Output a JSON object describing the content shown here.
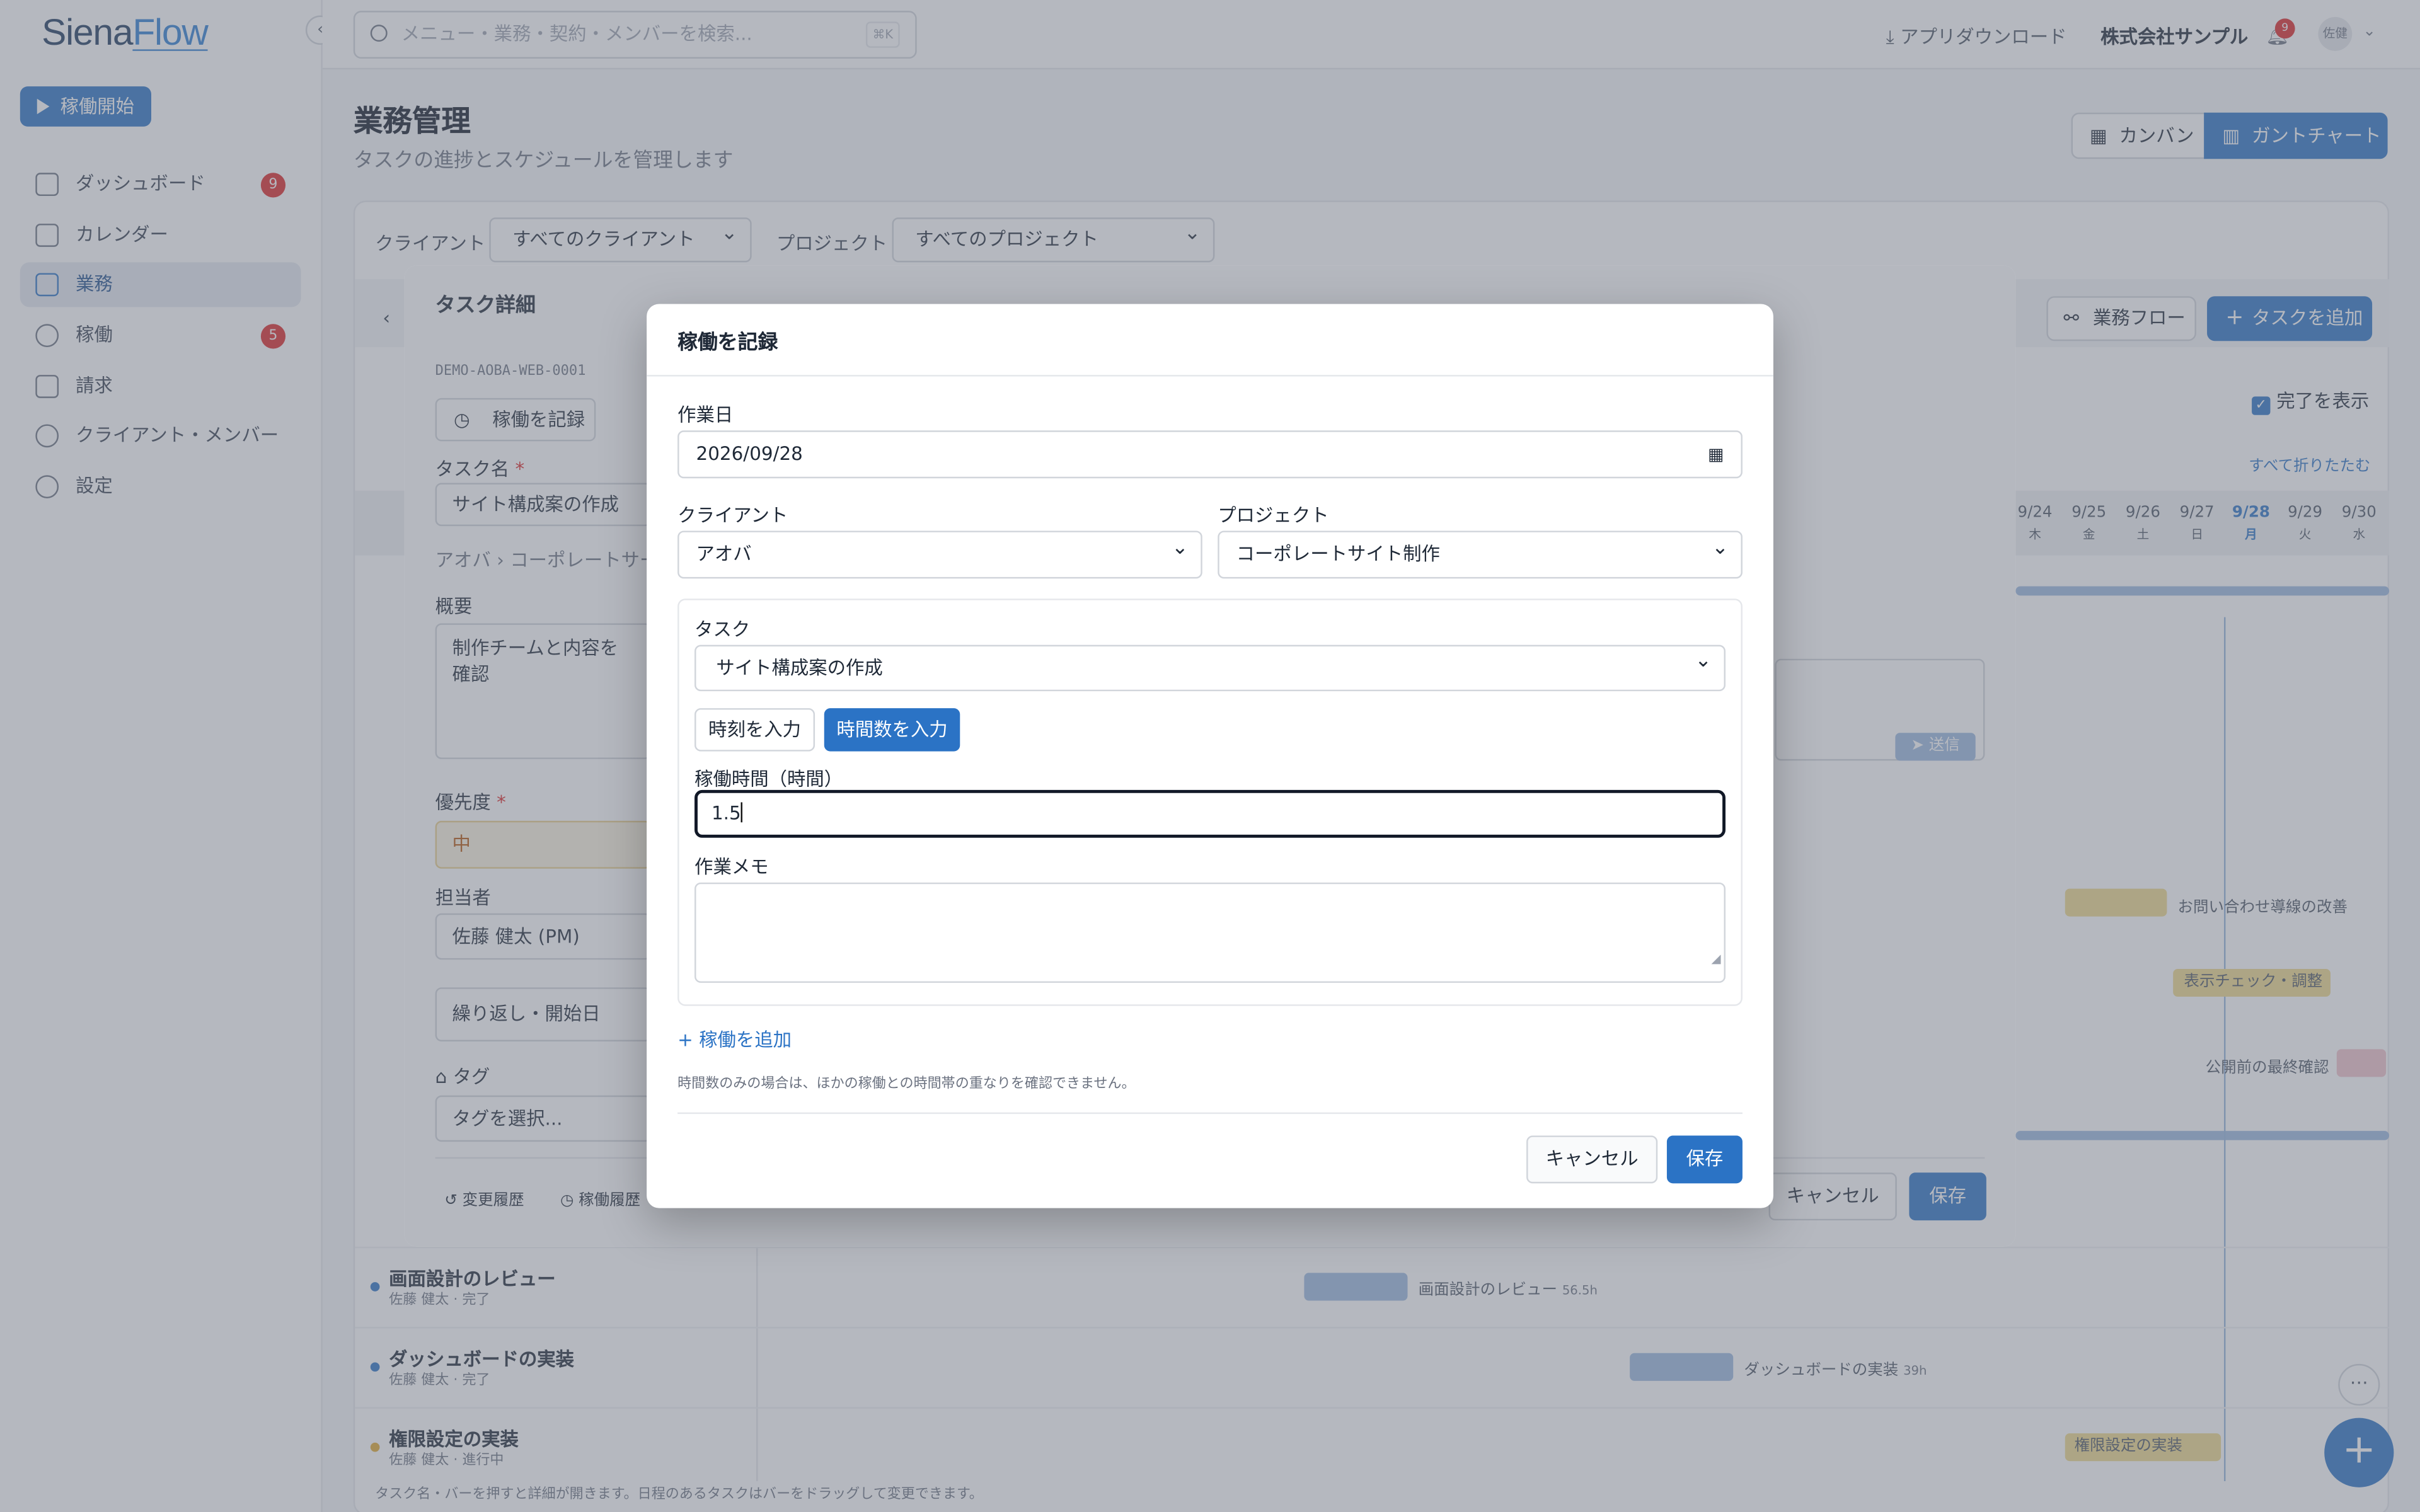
{
  "brand": {
    "part1": "Siena",
    "part2": "Flow"
  },
  "sidebar": {
    "start_label": "稼働開始",
    "items": [
      {
        "label": "ダッシュボード",
        "badge": "9"
      },
      {
        "label": "カレンダー"
      },
      {
        "label": "業務"
      },
      {
        "label": "稼働",
        "badge": "5"
      },
      {
        "label": "請求"
      },
      {
        "label": "クライアント・メンバー"
      },
      {
        "label": "設定"
      }
    ]
  },
  "topbar": {
    "search_placeholder": "メニュー・業務・契約・メンバーを検索...",
    "shortcut": "⌘K",
    "download_label": "アプリダウンロード",
    "company": "株式会社サンプル",
    "notif_count": "9",
    "user_initials": "佐健"
  },
  "page": {
    "title": "業務管理",
    "subtitle": "タスクの進捗とスケジュールを管理します",
    "view_kanban": "カンバン",
    "view_gantt": "ガントチャート"
  },
  "filters": {
    "client_label": "クライアント",
    "client_value": "すべてのクライアント",
    "project_label": "プロジェクト",
    "project_value": "すべてのプロジェクト"
  },
  "gantt": {
    "flow_button": "業務フロー",
    "add_task_button": "タスクを追加",
    "show_done_label": "完了を表示",
    "collapse_all": "すべて折りたたむ",
    "dates": [
      {
        "d": "9/24",
        "w": "木"
      },
      {
        "d": "9/25",
        "w": "金"
      },
      {
        "d": "9/26",
        "w": "土"
      },
      {
        "d": "9/27",
        "w": "日"
      },
      {
        "d": "9/28",
        "w": "月"
      },
      {
        "d": "9/29",
        "w": "火"
      },
      {
        "d": "9/30",
        "w": "水"
      }
    ],
    "bar_labels": {
      "inquiry": "お問い合わせ導線の改善",
      "display_check": "表示チェック・調整",
      "final_check": "公開前の最終確認",
      "screen_review": "画面設計のレビュー",
      "screen_review_hours": "56.5h",
      "dashboard_impl": "ダッシュボードの実装",
      "dashboard_hours": "39h",
      "permission_impl": "権限設定の実装"
    },
    "rows": [
      {
        "name": "画面設計のレビュー",
        "meta": "佐藤 健太 · 完了"
      },
      {
        "name": "ダッシュボードの実装",
        "meta": "佐藤 健太 · 完了"
      },
      {
        "name": "権限設定の実装",
        "meta": "佐藤 健太 · 進行中"
      }
    ],
    "footnote": "タスク名・バーを押すと詳細が開きます。日程のあるタスクはバーをドラッグして変更できます。"
  },
  "task_detail": {
    "title": "タスク詳細",
    "task_id": "DEMO-AOBA-WEB-0001",
    "record_button": "稼働を記録",
    "name_label": "タスク名",
    "name_value": "サイト構成案の作成",
    "breadcrumb_client": "アオバ",
    "breadcrumb_project": "コーポレートサー",
    "summary_label": "概要",
    "summary_value": "制作チームと内容を確認",
    "priority_label": "優先度",
    "priority_value": "中",
    "assignee_label": "担当者",
    "assignee_value": "佐藤 健太 (PM)",
    "repeat_label": "繰り返し・開始日",
    "tag_label": "タグ",
    "tag_placeholder": "タグを選択...",
    "history_label": "変更履歴",
    "work_history_label": "稼働履歴",
    "send_label": "送信",
    "cancel": "キャンセル",
    "save": "保存"
  },
  "modal": {
    "title": "稼働を記録",
    "date_label": "作業日",
    "date_value": "2026/09/28",
    "client_label": "クライアント",
    "client_value": "アオバ",
    "project_label": "プロジェクト",
    "project_value": "コーポレートサイト制作",
    "task_label": "タスク",
    "task_value": "サイト構成案の作成",
    "mode_time": "時刻を入力",
    "mode_hours": "時間数を入力",
    "hours_label": "稼働時間（時間）",
    "hours_value": "1.5",
    "memo_label": "作業メモ",
    "add_entry": "稼働を追加",
    "note": "時間数のみの場合は、ほかの稼働との時間帯の重なりを確認できません。",
    "cancel": "キャンセル",
    "save": "保存"
  },
  "colors": {
    "accent": "#2b73c5",
    "danger": "#dc2626",
    "bar_blue": "#9bb8de",
    "bar_yellow": "#efd98a",
    "bar_pink": "#f1c2cb"
  }
}
